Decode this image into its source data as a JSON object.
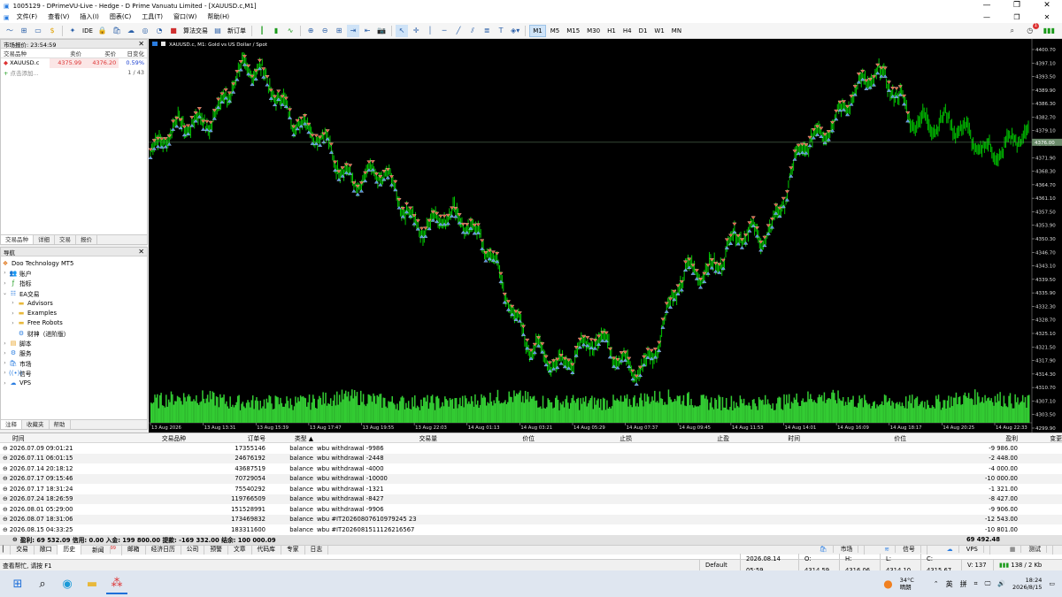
{
  "window": {
    "title": "1005129 - DPrimeVU-Live - Hedge - D Prime Vanuatu Limited - [XAUUSD.c,M1]"
  },
  "menu": [
    "文件(F)",
    "查看(V)",
    "插入(I)",
    "图表(C)",
    "工具(T)",
    "窗口(W)",
    "帮助(H)"
  ],
  "toolbar": {
    "ide_label": "IDE",
    "algo_label": "算法交易",
    "neworder_label": "新订单",
    "timeframes": [
      "M1",
      "M5",
      "M15",
      "M30",
      "H1",
      "H4",
      "D1",
      "W1",
      "MN"
    ],
    "active_tf": "M1",
    "notif_count": "1"
  },
  "market_watch": {
    "title": "市场报价: 23:54:59",
    "columns": [
      "交易品种",
      "卖价",
      "买价",
      "日变化"
    ],
    "rows": [
      {
        "symbol": "XAUUSD.c",
        "bid": "4375.99",
        "ask": "4376.20",
        "change": "0.59%"
      }
    ],
    "add_label": "点击添加...",
    "count": "1 / 43",
    "tabs": [
      "交易品种",
      "详细",
      "交易",
      "报价"
    ]
  },
  "navigator": {
    "title": "导航",
    "root": "Doo Technology MT5",
    "items": [
      {
        "label": "账户",
        "level": 1,
        "icon": "accounts-icon"
      },
      {
        "label": "指标",
        "level": 1,
        "icon": "indicators-icon"
      },
      {
        "label": "EA交易",
        "level": 1,
        "icon": "expert-advisors-icon"
      },
      {
        "label": "Advisors",
        "level": 2,
        "icon": "folder-icon"
      },
      {
        "label": "Examples",
        "level": 2,
        "icon": "folder-icon"
      },
      {
        "label": "Free Robots",
        "level": 2,
        "icon": "folder-icon"
      },
      {
        "label": "财神（进阶版）",
        "level": 2,
        "icon": "robot-icon"
      },
      {
        "label": "脚本",
        "level": 1,
        "icon": "scripts-icon"
      },
      {
        "label": "服务",
        "level": 1,
        "icon": "services-icon"
      },
      {
        "label": "市场",
        "level": 1,
        "icon": "market-icon"
      },
      {
        "label": "信号",
        "level": 1,
        "icon": "signals-icon"
      },
      {
        "label": "VPS",
        "level": 1,
        "icon": "vps-icon"
      }
    ],
    "tabs": [
      "注释",
      "收藏夹",
      "帮助"
    ]
  },
  "chart": {
    "tab_label": "XAUUSD.c, M1:  Gold vs US Dollar / Spot",
    "price_labels": [
      "4400.70",
      "4397.10",
      "4393.50",
      "4389.90",
      "4386.30",
      "4382.70",
      "4379.10",
      "4375.50",
      "4371.90",
      "4368.30",
      "4364.70",
      "4361.10",
      "4357.50",
      "4353.90",
      "4350.30",
      "4346.70",
      "4343.10",
      "4339.50",
      "4335.90",
      "4332.30",
      "4328.70",
      "4325.10",
      "4321.50",
      "4317.90",
      "4314.30",
      "4310.70",
      "4307.10",
      "4303.50",
      "4299.90"
    ],
    "current_price": "4376.00",
    "time_labels": [
      "13 Aug 2026",
      "13 Aug 13:31",
      "13 Aug 15:39",
      "13 Aug 17:47",
      "13 Aug 19:55",
      "13 Aug 22:03",
      "14 Aug 01:13",
      "14 Aug 03:21",
      "14 Aug 05:29",
      "14 Aug 07:37",
      "14 Aug 09:45",
      "14 Aug 11:53",
      "14 Aug 14:01",
      "14 Aug 16:09",
      "14 Aug 18:17",
      "14 Aug 20:25",
      "14 Aug 22:33"
    ],
    "colors": {
      "background": "#000000",
      "candle": "#00c800",
      "volume": "#33cc33",
      "buy_marker": "#4a8fe0",
      "sell_marker": "#e05a3a"
    }
  },
  "chart_data": {
    "type": "line",
    "symbol": "XAUUSD.c",
    "timeframe": "M1",
    "ylim": [
      4299.9,
      4400.7
    ],
    "x": [
      "13 Aug 2026",
      "13 Aug 13:31",
      "13 Aug 15:39",
      "13 Aug 17:47",
      "13 Aug 19:55",
      "13 Aug 22:03",
      "14 Aug 01:13",
      "14 Aug 03:21",
      "14 Aug 05:29",
      "14 Aug 07:37",
      "14 Aug 09:45",
      "14 Aug 11:53",
      "14 Aug 14:01",
      "14 Aug 16:09",
      "14 Aug 18:17",
      "14 Aug 20:25",
      "14 Aug 22:33"
    ],
    "series": [
      {
        "values": [
          4373,
          4384,
          4395,
          4376,
          4366,
          4356,
          4352,
          4319,
          4321,
          4318,
          4344,
          4350,
          4374,
          4393,
          4384,
          4376,
          4376
        ]
      }
    ]
  },
  "history": {
    "columns": [
      "时间",
      "交易品种",
      "订单号",
      "类型",
      "交易量",
      "价位",
      "止损",
      "止盈",
      "时间",
      "价位",
      "盈利",
      "变更"
    ],
    "rows": [
      {
        "time": "2026.07.09 09:01:21",
        "order": "17355146",
        "type": "balance",
        "comment": "wbu withdrawal -9986",
        "profit": "-9 986.00"
      },
      {
        "time": "2026.07.11 06:01:15",
        "order": "24676192",
        "type": "balance",
        "comment": "wbu withdrawal -2448",
        "profit": "-2 448.00"
      },
      {
        "time": "2026.07.14 20:18:12",
        "order": "43687519",
        "type": "balance",
        "comment": "wbu withdrawal -4000",
        "profit": "-4 000.00"
      },
      {
        "time": "2026.07.17 09:15:46",
        "order": "70729054",
        "type": "balance",
        "comment": "wbu withdrawal -10000",
        "profit": "-10 000.00"
      },
      {
        "time": "2026.07.17 18:31:24",
        "order": "75540292",
        "type": "balance",
        "comment": "wbu withdrawal -1321",
        "profit": "-1 321.00"
      },
      {
        "time": "2026.07.24 18:26:59",
        "order": "119766509",
        "type": "balance",
        "comment": "wbu withdrawal -8427",
        "profit": "-8 427.00"
      },
      {
        "time": "2026.08.01 05:29:00",
        "order": "151528991",
        "type": "balance",
        "comment": "wbu withdrawal -9906",
        "profit": "-9 906.00"
      },
      {
        "time": "2026.08.07 18:31:06",
        "order": "173469832",
        "type": "balance",
        "comment": "wbu #IT20260807610979245 23",
        "profit": "-12 543.00"
      },
      {
        "time": "2026.08.15 04:33:25",
        "order": "183311600",
        "type": "balance",
        "comment": "wbu #IT2026081511126216567",
        "profit": "-10 801.00"
      }
    ],
    "summary_label": "盈利: 69 532.09  信用: 0.00  入金: 199 800.00  提款: -169 332.00  结余: 100 000.09",
    "summary_value": "69 492.48"
  },
  "bottom_tabs": [
    "交易",
    "敞口",
    "历史",
    "新闻",
    "邮箱",
    "经济日历",
    "公司",
    "预警",
    "文章",
    "代码库",
    "专家",
    "日志"
  ],
  "bottom_tabs_active": "历史",
  "news_badge": "99",
  "bottom_right": [
    "市场",
    "信号",
    "VPS",
    "测试"
  ],
  "status": {
    "help": "查看帮忙, 请按 F1",
    "profile": "Default",
    "datetime": "2026.08.14 05:59",
    "open": "O: 4314.59",
    "high": "H: 4316.06",
    "low": "L: 4314.10",
    "close": "C: 4315.67",
    "volume": "V: 137",
    "traffic": "138 / 2 Kb"
  },
  "taskbar": {
    "weather_temp": "34°C",
    "weather_desc": "晴朗",
    "ime1": "英",
    "ime2": "拼",
    "clock_time": "18:24",
    "clock_date": "2026/8/15"
  }
}
